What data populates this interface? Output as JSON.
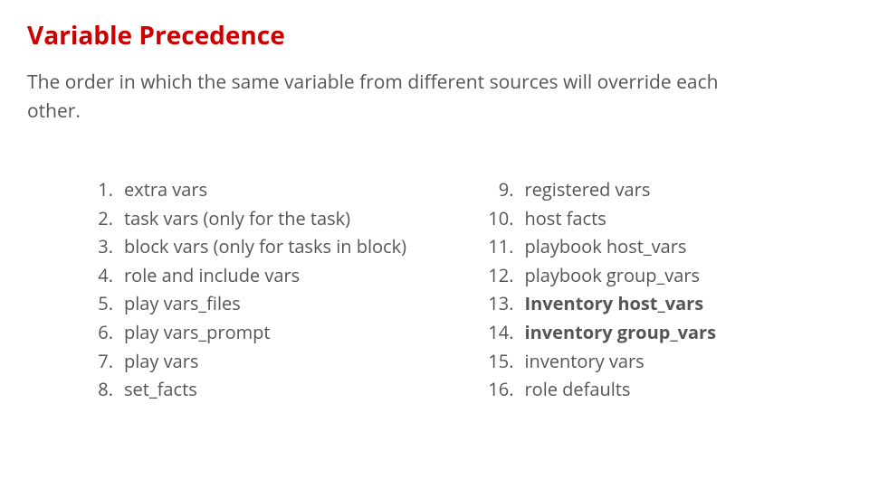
{
  "title": "Variable Precedence",
  "description": "The order in which the same variable from different sources will override each other.",
  "leftItems": [
    {
      "text": "extra vars",
      "bold": false
    },
    {
      "text": "task vars (only for the task)",
      "bold": false
    },
    {
      "text": "block vars (only for tasks in block)",
      "bold": false
    },
    {
      "text": "role and include vars",
      "bold": false
    },
    {
      "text": "play vars_files",
      "bold": false
    },
    {
      "text": "play vars_prompt",
      "bold": false
    },
    {
      "text": "play vars",
      "bold": false
    },
    {
      "text": "set_facts",
      "bold": false
    }
  ],
  "rightItems": [
    {
      "text": "registered vars",
      "bold": false
    },
    {
      "text": "host facts",
      "bold": false
    },
    {
      "text": "playbook host_vars",
      "bold": false
    },
    {
      "text": "playbook group_vars",
      "bold": false
    },
    {
      "text": "Inventory host_vars",
      "bold": true
    },
    {
      "text": "inventory group_vars",
      "bold": true
    },
    {
      "text": "inventory vars",
      "bold": false
    },
    {
      "text": "role defaults",
      "bold": false
    }
  ]
}
